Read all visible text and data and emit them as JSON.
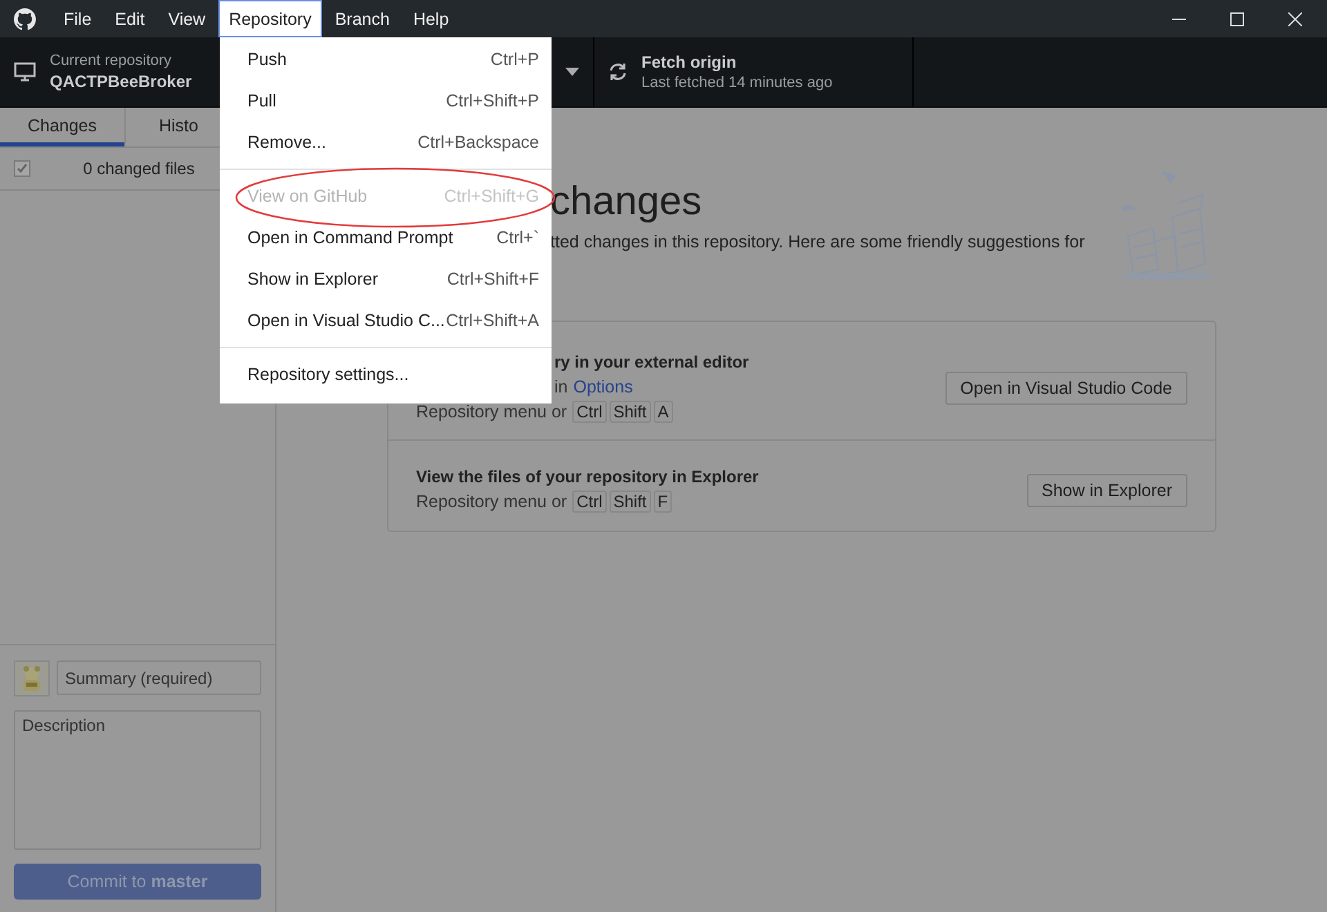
{
  "title_bar": {
    "menus": [
      {
        "label": "File",
        "selected": false
      },
      {
        "label": "Edit",
        "selected": false
      },
      {
        "label": "View",
        "selected": false
      },
      {
        "label": "Repository",
        "selected": true
      },
      {
        "label": "Branch",
        "selected": false
      },
      {
        "label": "Help",
        "selected": false
      }
    ]
  },
  "toolbar": {
    "repository": {
      "label": "Current repository",
      "name": "QACTPBeeBroker"
    },
    "fetch": {
      "title": "Fetch origin",
      "subtitle": "Last fetched 14 minutes ago"
    }
  },
  "sidebar": {
    "tabs": [
      {
        "label": "Changes",
        "selected": true
      },
      {
        "label": "Histo",
        "selected": false
      }
    ],
    "changes": {
      "checked": true,
      "label": "0 changed files"
    },
    "summary": {
      "placeholder": "Summary (required)"
    },
    "description": {
      "placeholder": "Description"
    },
    "commit_button": "Commit to **master**"
  },
  "main": {
    "heading": "changes",
    "text": "tted changes in this repository. Here are some friendly suggestions for",
    "suggestions": [
      {
        "title": "ry in your external editor",
        "hint": "in",
        "link": "Options",
        "prefix": "Repository menu or",
        "keys": [
          "Ctrl",
          "Shift",
          "A"
        ],
        "button": "Open in Visual Studio Code"
      },
      {
        "title": "View the files of your repository in Explorer",
        "prefix": "Repository menu or",
        "keys": [
          "Ctrl",
          "Shift",
          "F"
        ],
        "button": "Show in Explorer"
      }
    ]
  },
  "menu": {
    "items": [
      {
        "kind": "item",
        "label": "Push",
        "shortcut": "Ctrl+P",
        "disabled": false
      },
      {
        "kind": "item",
        "label": "Pull",
        "shortcut": "Ctrl+Shift+P",
        "disabled": false
      },
      {
        "kind": "item",
        "label": "Remove...",
        "shortcut": "Ctrl+Backspace",
        "disabled": false
      },
      {
        "kind": "separator"
      },
      {
        "kind": "item",
        "label": "View on GitHub",
        "shortcut": "Ctrl+Shift+G",
        "disabled": true
      },
      {
        "kind": "item",
        "label": "Open in Command Prompt",
        "shortcut": "Ctrl+`",
        "disabled": false
      },
      {
        "kind": "item",
        "label": "Show in Explorer",
        "shortcut": "Ctrl+Shift+F",
        "disabled": false
      },
      {
        "kind": "item",
        "label": "Open in Visual Studio C...",
        "shortcut": "Ctrl+Shift+A",
        "disabled": false
      },
      {
        "kind": "separator"
      },
      {
        "kind": "item",
        "label": "Repository settings...",
        "disabled": false
      }
    ]
  }
}
